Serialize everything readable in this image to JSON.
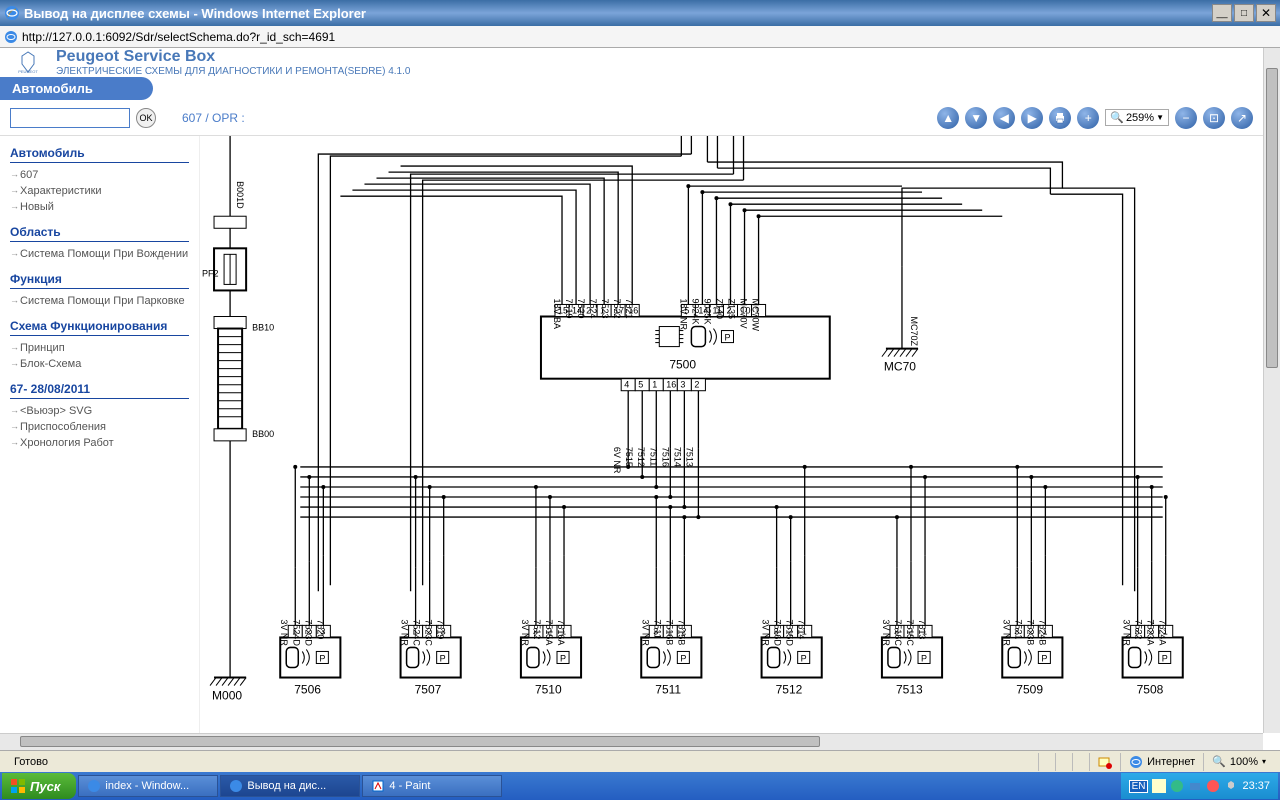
{
  "window": {
    "title": "Вывод на дисплее схемы - Windows Internet Explorer",
    "url": "http://127.0.0.1:6092/Sdr/selectSchema.do?r_id_sch=4691"
  },
  "brand": {
    "title": "Peugeot Service Box",
    "logo_text": "PEUGEOT",
    "subtitle": "ЭЛЕКТРИЧЕСКИЕ СХЕМЫ ДЛЯ ДИАГНОСТИКИ И РЕМОНТА(SEDRE) 4.1.0"
  },
  "subbar": {
    "label": "Автомобиль"
  },
  "toolrow": {
    "ok": "OK",
    "crumb": "607  /  OPR :",
    "zoom": "259%"
  },
  "sidebar": {
    "sections": [
      {
        "title": "Автомобиль",
        "items": [
          "607",
          "Характеристики",
          "Новый"
        ]
      },
      {
        "title": "Область",
        "items": [
          "Система Помощи При Вождении"
        ]
      },
      {
        "title": "Функция",
        "items": [
          "Система Помощи При Парковке"
        ]
      },
      {
        "title": "Схема Функционирования",
        "items": [
          "Принцип",
          "Блок-Схема"
        ]
      },
      {
        "title": "67- 28/08/2011",
        "items": [
          "<Вьюэр> SVG",
          "Приспособления",
          "Хронология Работ"
        ]
      }
    ]
  },
  "diagram": {
    "main_ecu": "7500",
    "ground_left": "M000",
    "ground_right": "MC70",
    "mc70z": "MC70Z",
    "fuse": "PF2",
    "conn_top": "B001D",
    "conn_mid": "BB10",
    "conn_bot": "BB00",
    "top_left_pins": [
      "15",
      "14",
      "2",
      "1",
      "17",
      "16"
    ],
    "top_left_wires": [
      "18V BA",
      "7519",
      "7520",
      "7524",
      "7523",
      "7522",
      "7521"
    ],
    "top_right_pins": [
      "5",
      "14",
      "11",
      "2",
      "10",
      "1"
    ],
    "top_right_wires": [
      "18V NR",
      "9024K",
      "9025K",
      "Z140",
      "Z135",
      "MC70V",
      "MC70W"
    ],
    "bot_pins": [
      "4",
      "5",
      "1",
      "16",
      "3",
      "2"
    ],
    "bot_wires": [
      "6V NR",
      "7515",
      "7512",
      "7511",
      "7516",
      "7514",
      "7513"
    ],
    "sensors": [
      {
        "id": "7506",
        "pins": [
          "1",
          "2",
          "3"
        ],
        "wires": [
          "3V NR",
          "7524D",
          "7523D",
          "7520"
        ]
      },
      {
        "id": "7507",
        "pins": [
          "1",
          "2",
          "3"
        ],
        "wires": [
          "3V NR",
          "7524C",
          "7523C",
          "7519"
        ]
      },
      {
        "id": "7510",
        "pins": [
          "3",
          "2",
          "1"
        ],
        "wires": [
          "3V NR",
          "7512",
          "7515A",
          "7516A"
        ]
      },
      {
        "id": "7511",
        "pins": [
          "3",
          "1",
          "2"
        ],
        "wires": [
          "3V NR",
          "7511",
          "7516B",
          "7515B"
        ]
      },
      {
        "id": "7512",
        "pins": [
          "3",
          "2",
          "1"
        ],
        "wires": [
          "3V NR",
          "7516D",
          "7515D",
          "7514"
        ]
      },
      {
        "id": "7513",
        "pins": [
          "3",
          "2",
          "1"
        ],
        "wires": [
          "3V NR",
          "7516C",
          "7515C",
          "7513"
        ]
      },
      {
        "id": "7509",
        "pins": [
          "3",
          "2",
          "1"
        ],
        "wires": [
          "3V NR",
          "7521",
          "7523B",
          "7524B"
        ]
      },
      {
        "id": "7508",
        "pins": [
          "3",
          "2",
          "1"
        ],
        "wires": [
          "3V NR",
          "7522",
          "7523A",
          "7524A"
        ]
      }
    ]
  },
  "statusbar": {
    "ready": "Готово",
    "zone": "Интернет",
    "zoom": "100%"
  },
  "taskbar": {
    "start": "Пуск",
    "tasks": [
      "index - Window...",
      "Вывод на дис...",
      "4 - Paint"
    ],
    "lang": "EN",
    "time": "23:37"
  }
}
